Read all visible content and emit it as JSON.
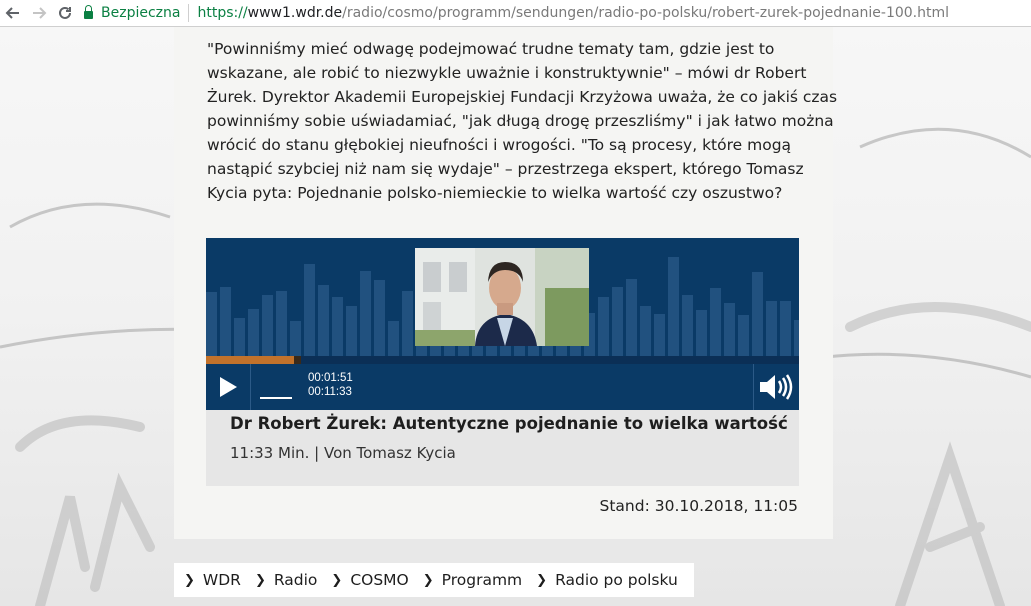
{
  "browser": {
    "secure_label": "Bezpieczna",
    "url_proto": "https://",
    "url_host": "www1.wdr.de",
    "url_path": "/radio/cosmo/programm/sendungen/radio-po-polsku/robert-zurek-pojednanie-100.html",
    "icons": {
      "back": "back-arrow-icon",
      "forward": "forward-arrow-icon",
      "reload": "reload-icon",
      "lock": "lock-icon"
    },
    "colors": {
      "secure": "#0b8043"
    }
  },
  "article": {
    "lines": [
      "\"Powinniśmy mieć odwagę podejmować trudne tematy tam, gdzie jest to",
      "wskazane, ale robić to niezwykle uważnie i konstruktywnie\" – mówi dr Robert",
      "Żurek. Dyrektor Akademii Europejskiej Fundacji Krzyżowa uważa, że co jakiś czas",
      "powinniśmy sobie uświadamiać, \"jak długą drogę przeszliśmy\" i jak łatwo można",
      "wrócić do stanu głębokiej nieufności i wrogości. \"To są procesy, które mogą",
      "nastąpić szybciej niż nam się wydaje\" – przestrzega ekspert, którego Tomasz",
      "Kycia pyta: Pojednanie polsko-niemieckie to wielka wartość czy oszustwo?"
    ]
  },
  "player": {
    "elapsed": "00:01:51",
    "duration": "00:11:33",
    "progress_fraction": 0.16,
    "play_icon": "play-icon",
    "volume_icon": "speaker-icon",
    "colors": {
      "background": "#0a3a66",
      "progress": "#c2722b"
    }
  },
  "audio": {
    "title": "Dr Robert Żurek: Autentyczne pojednanie to wielka wartość",
    "subtitle": "11:33 Min. | Von Tomasz Kycia"
  },
  "stand": "Stand: 30.10.2018, 11:05",
  "breadcrumb": [
    "WDR",
    "Radio",
    "COSMO",
    "Programm",
    "Radio po polsku"
  ]
}
